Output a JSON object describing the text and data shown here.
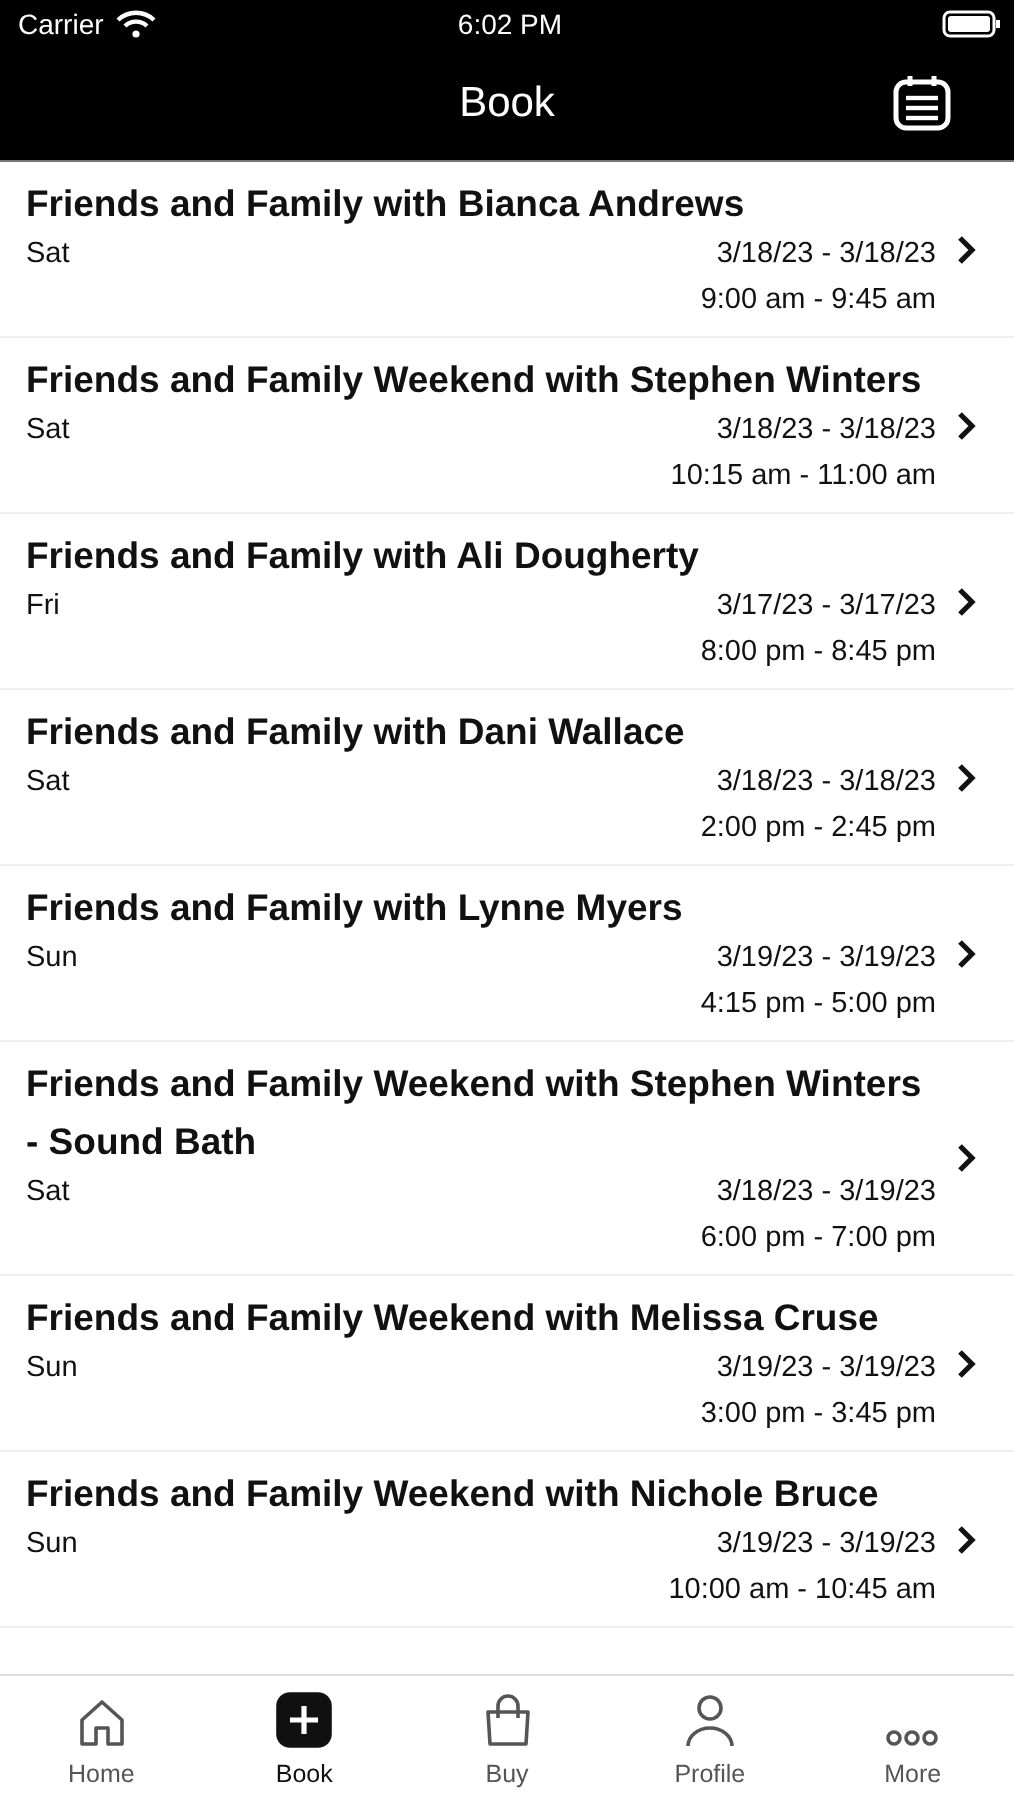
{
  "status_bar": {
    "carrier": "Carrier",
    "time": "6:02 PM"
  },
  "nav": {
    "title": "Book"
  },
  "sessions": [
    {
      "title": "Friends and Family with Bianca Andrews",
      "day": "Sat",
      "dates": "3/18/23 - 3/18/23",
      "time": "9:00 am - 9:45 am"
    },
    {
      "title": "Friends and Family Weekend with Stephen Winters",
      "day": "Sat",
      "dates": "3/18/23 - 3/18/23",
      "time": "10:15 am - 11:00 am"
    },
    {
      "title": "Friends and Family with Ali Dougherty",
      "day": "Fri",
      "dates": "3/17/23 - 3/17/23",
      "time": "8:00 pm - 8:45 pm"
    },
    {
      "title": "Friends and Family with Dani Wallace",
      "day": "Sat",
      "dates": "3/18/23 - 3/18/23",
      "time": "2:00 pm - 2:45 pm"
    },
    {
      "title": "Friends and Family with Lynne Myers",
      "day": "Sun",
      "dates": "3/19/23 - 3/19/23",
      "time": "4:15 pm - 5:00 pm"
    },
    {
      "title": "Friends and Family Weekend with Stephen Winters - Sound Bath",
      "day": "Sat",
      "dates": "3/18/23 - 3/19/23",
      "time": "6:00 pm - 7:00 pm"
    },
    {
      "title": "Friends and Family Weekend with Melissa Cruse",
      "day": "Sun",
      "dates": "3/19/23 - 3/19/23",
      "time": "3:00 pm - 3:45 pm"
    },
    {
      "title": "Friends and Family Weekend with Nichole Bruce",
      "day": "Sun",
      "dates": "3/19/23 - 3/19/23",
      "time": "10:00 am - 10:45 am"
    }
  ],
  "tab_bar": [
    {
      "kind": "home",
      "label": "Home",
      "selected": false
    },
    {
      "kind": "book",
      "label": "Book",
      "selected": true
    },
    {
      "kind": "buy",
      "label": "Buy",
      "selected": false
    },
    {
      "kind": "profile",
      "label": "Profile",
      "selected": false
    },
    {
      "kind": "more",
      "label": "More",
      "selected": false
    }
  ]
}
